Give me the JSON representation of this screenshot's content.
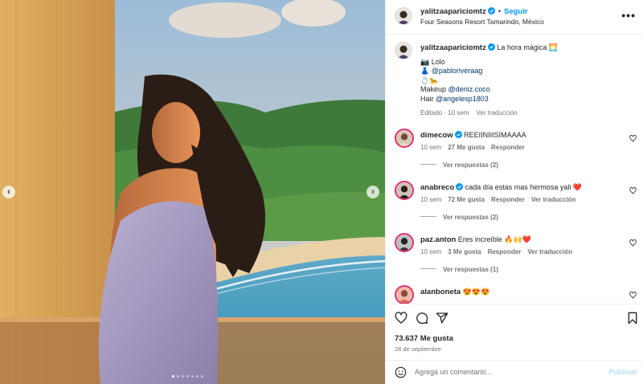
{
  "post": {
    "author": "yalitzaapariciomtz",
    "follow_label": "Seguir",
    "location": "Four Seasons Resort Tamarindo, México",
    "more_label": "•••"
  },
  "caption": {
    "username": "yalitzaapariciomtz",
    "title": "La hora mágica 🌅",
    "lines": [
      {
        "prefix": "📷 ",
        "text": "Lolo",
        "link": false
      },
      {
        "prefix": "👗 ",
        "text": "@pabloriveraag",
        "link": true
      },
      {
        "prefix": "",
        "text": "💍🐆",
        "link": false
      }
    ],
    "makeup_label": "Makeup",
    "makeup_handle": "@deniz.coco",
    "hair_label": "Hair",
    "hair_handle": "@angelesp1803",
    "edited": "Editado · 10 sem",
    "translate": "Ver traducción"
  },
  "comments": [
    {
      "username": "dimecow",
      "verified": true,
      "text": "REEIINIIISIMAAAA",
      "time": "10 sem",
      "likes": "27 Me gusta",
      "reply": "Responder",
      "translate": "",
      "replies": "Ver respuestas (2)"
    },
    {
      "username": "anabreco",
      "verified": true,
      "text": "cada día estas mas hermosa yali ❤️",
      "time": "10 sem",
      "likes": "72 Me gusta",
      "reply": "Responder",
      "translate": "Ver traducción",
      "replies": "Ver respuestas (2)"
    },
    {
      "username": "paz.anton",
      "verified": false,
      "text": "Eres increíble 🔥🙌❤️",
      "time": "10 sem",
      "likes": "3 Me gusta",
      "reply": "Responder",
      "translate": "Ver traducción",
      "replies": "Ver respuestas (1)"
    },
    {
      "username": "alanboneta",
      "verified": false,
      "text": "😍😍😍",
      "time": "",
      "likes": "",
      "reply": "",
      "translate": "",
      "replies": ""
    }
  ],
  "stats": {
    "likes": "73.637 Me gusta",
    "date": "28 de septiembre"
  },
  "composer": {
    "placeholder": "Agrega un comentario...",
    "post_label": "Publicar"
  },
  "icons": {
    "like": "heart-icon",
    "comment": "comment-icon",
    "share": "paper-plane-icon",
    "save": "bookmark-icon",
    "emoji": "emoji-icon",
    "verified": "verified-badge-icon",
    "prev": "chevron-left-icon",
    "next": "chevron-right-icon"
  },
  "colors": {
    "accent": "#0095f6",
    "link": "#00376b",
    "muted": "#737373",
    "story_ring": "#e1306c"
  },
  "carousel": {
    "slide_count": 7,
    "active_index": 0
  }
}
